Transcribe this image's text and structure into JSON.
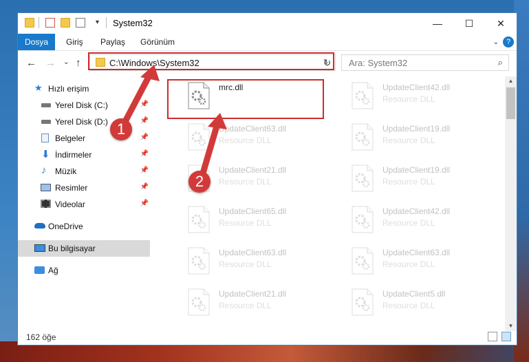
{
  "window": {
    "title": "System32",
    "controls": {
      "minimize": "—",
      "maximize": "☐",
      "close": "✕"
    }
  },
  "ribbon": {
    "tabs": [
      "Dosya",
      "Giriş",
      "Paylaş",
      "Görünüm"
    ],
    "help": "?"
  },
  "nav": {
    "address": "C:\\Windows\\System32",
    "search_placeholder": "Ara: System32"
  },
  "sidebar": {
    "items": [
      {
        "label": "Hızlı erişim",
        "icon": "star-icon"
      },
      {
        "label": "Yerel Disk (C:)",
        "icon": "drive-icon",
        "pinned": true
      },
      {
        "label": "Yerel Disk (D:)",
        "icon": "drive-icon",
        "pinned": true
      },
      {
        "label": "Belgeler",
        "icon": "documents-icon",
        "pinned": true
      },
      {
        "label": "İndirmeler",
        "icon": "download-icon",
        "pinned": true
      },
      {
        "label": "Müzik",
        "icon": "music-icon",
        "pinned": true
      },
      {
        "label": "Resimler",
        "icon": "pictures-icon",
        "pinned": true
      },
      {
        "label": "Videolar",
        "icon": "video-icon",
        "pinned": true
      },
      {
        "label": "OneDrive",
        "icon": "cloud-icon"
      },
      {
        "label": "Bu bilgisayar",
        "icon": "computer-icon",
        "selected": true
      },
      {
        "label": "Ağ",
        "icon": "network-icon"
      }
    ]
  },
  "files": {
    "left": [
      {
        "name": "mrc.dll",
        "type": ""
      },
      {
        "name": "UpdateClient63.dll",
        "type": "Resource DLL"
      },
      {
        "name": "UpdateClient21.dll",
        "type": "Resource DLL"
      },
      {
        "name": "UpdateClient65.dll",
        "type": "Resource DLL"
      },
      {
        "name": "UpdateClient63.dll",
        "type": "Resource DLL"
      },
      {
        "name": "UpdateClient21.dll",
        "type": "Resource DLL"
      }
    ],
    "right": [
      {
        "name": "UpdateClient42.dll",
        "type": "Resource DLL"
      },
      {
        "name": "UpdateClient19.dll",
        "type": "Resource DLL"
      },
      {
        "name": "UpdateClient19.dll",
        "type": "Resource DLL"
      },
      {
        "name": "UpdateClient42.dll",
        "type": "Resource DLL"
      },
      {
        "name": "UpdateClient63.dll",
        "type": "Resource DLL"
      },
      {
        "name": "UpdateClient5.dll",
        "type": "Resource DLL"
      }
    ]
  },
  "status": {
    "count": "162 öğe"
  },
  "annotations": {
    "step1": "1",
    "step2": "2",
    "color": "#d23a3a"
  }
}
